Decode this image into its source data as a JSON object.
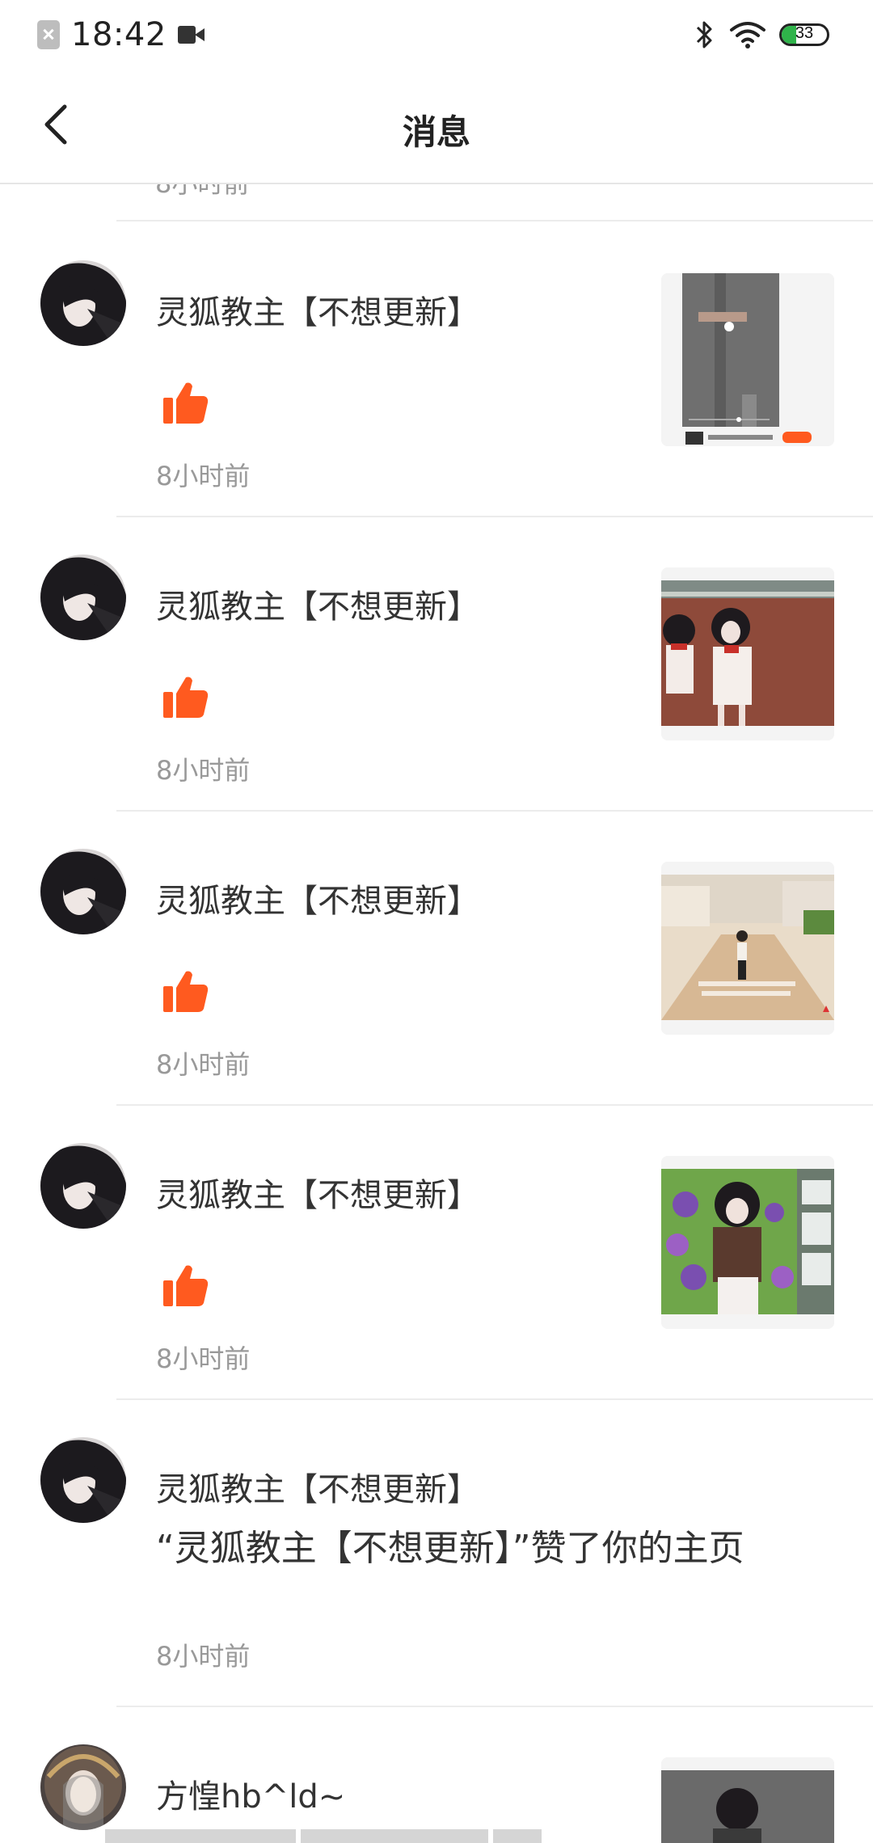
{
  "status_bar": {
    "time": "18:42",
    "battery": "33",
    "icons": [
      "notification-blocked-icon",
      "video-icon",
      "bluetooth-icon",
      "wifi-icon",
      "battery-icon"
    ]
  },
  "header": {
    "title": "消息",
    "back_icon": "chevron-left-icon"
  },
  "partial_top_time": "8小时前",
  "messages": [
    {
      "user": "灵狐教主【不想更新】",
      "type": "like",
      "time": "8小时前",
      "thumb": "video-screenshot"
    },
    {
      "user": "灵狐教主【不想更新】",
      "type": "like",
      "time": "8小时前",
      "thumb": "two-girls"
    },
    {
      "user": "灵狐教主【不想更新】",
      "type": "like",
      "time": "8小时前",
      "thumb": "street-scene"
    },
    {
      "user": "灵狐教主【不想更新】",
      "type": "like",
      "time": "8小时前",
      "thumb": "girl-flowers"
    },
    {
      "user": "灵狐教主【不想更新】",
      "type": "profile-like",
      "text": "“灵狐教主【不想更新】”赞了你的主页",
      "time": "8小时前"
    },
    {
      "user": "方惶hb^ld~",
      "type": "like",
      "thumb": "girl-partial"
    }
  ],
  "colors": {
    "like": "#ff5a1f",
    "time": "#999999",
    "name": "#333333",
    "divider": "#ececec"
  }
}
